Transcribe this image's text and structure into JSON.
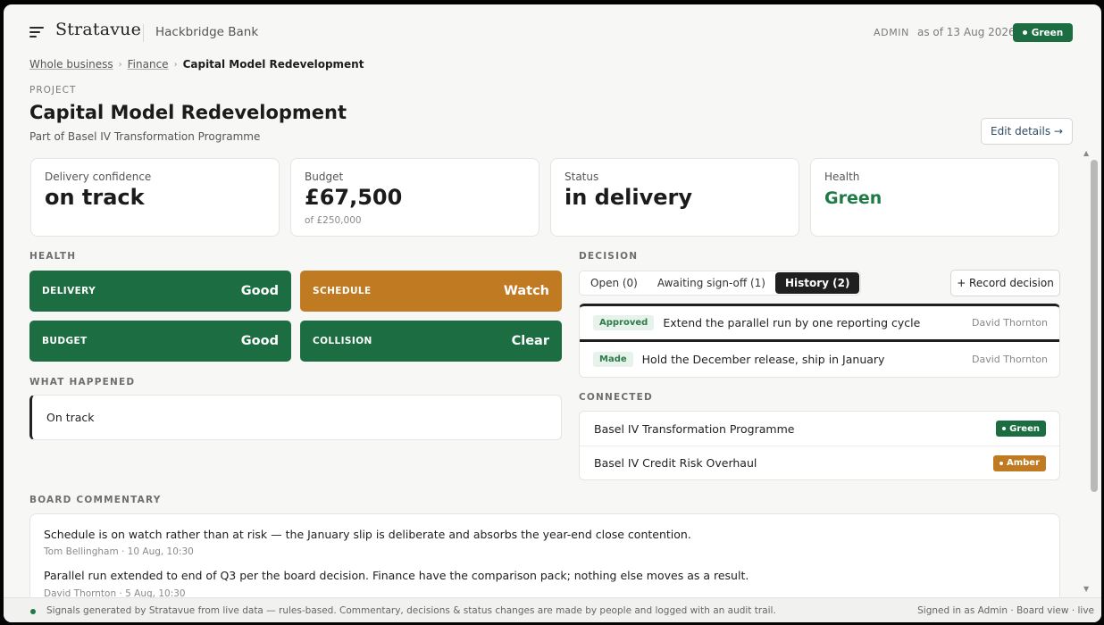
{
  "header": {
    "brand": "Stratavue",
    "org": "Hackbridge Bank",
    "role": "ADMIN",
    "as_of": "as of 13 Aug 2026",
    "status_badge": "Green"
  },
  "breadcrumb": [
    "Whole business",
    "Finance",
    "Capital Model Redevelopment"
  ],
  "project": {
    "eyebrow": "PROJECT",
    "title": "Capital Model Redevelopment",
    "subtitle": "Part of Basel IV Transformation Programme",
    "edit_label": "Edit details →"
  },
  "cards": [
    {
      "label": "Delivery confidence",
      "value": "on track",
      "sub": ""
    },
    {
      "label": "Budget",
      "value": "£67,500",
      "sub": "of £250,000"
    },
    {
      "label": "Status",
      "value": "in delivery",
      "sub": ""
    },
    {
      "label": "Health",
      "value": "Green",
      "sub": ""
    }
  ],
  "health": {
    "label": "HEALTH",
    "tiles": [
      {
        "label": "DELIVERY",
        "value": "Good",
        "color": "#1c6e42"
      },
      {
        "label": "SCHEDULE",
        "value": "Watch",
        "color": "#c07a22"
      },
      {
        "label": "BUDGET",
        "value": "Good",
        "color": "#1c6e42"
      },
      {
        "label": "COLLISION",
        "value": "Clear",
        "color": "#1c6e42"
      }
    ]
  },
  "what_happened": {
    "label": "WHAT HAPPENED",
    "text": "On track"
  },
  "decision": {
    "label": "DECISION",
    "tabs": [
      "Open (0)",
      "Awaiting sign-off (1)",
      "History (2)"
    ],
    "active_tab": "History (2)",
    "record_label": "+ Record decision",
    "items": [
      {
        "pill": "Approved",
        "text": "Extend the parallel run by one reporting cycle",
        "who": "David Thornton"
      },
      {
        "pill": "Made",
        "text": "Hold the December release, ship in January",
        "who": "David Thornton"
      }
    ]
  },
  "connected": {
    "label": "CONNECTED",
    "items": [
      {
        "name": "Basel IV Transformation Programme",
        "status": "Green",
        "color": "#1c6e42"
      },
      {
        "name": "Basel IV Credit Risk Overhaul",
        "status": "Amber",
        "color": "#c07a22"
      }
    ]
  },
  "commentary": {
    "label": "BOARD COMMENTARY",
    "items": [
      {
        "text": "Schedule is on watch rather than at risk — the January slip is deliberate and absorbs the year-end close contention.",
        "meta": "Tom Bellingham · 10 Aug, 10:30"
      },
      {
        "text": "Parallel run extended to end of Q3 per the board decision. Finance have the comparison pack; nothing else moves as a result.",
        "meta": "David Thornton · 5 Aug, 10:30"
      }
    ]
  },
  "footer": {
    "left": "Signals generated by Stratavue from live data — rules-based. Commentary, decisions & status changes are made by people and logged with an audit trail.",
    "right": "Signed in as Admin · Board view · live"
  }
}
